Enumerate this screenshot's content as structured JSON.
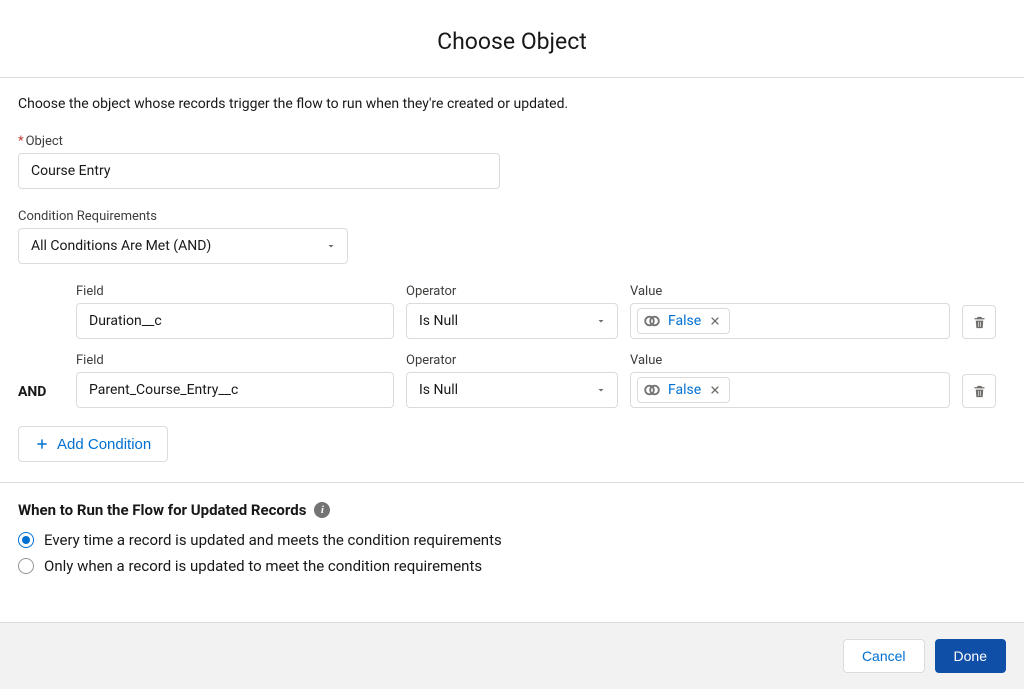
{
  "modal": {
    "title": "Choose Object",
    "helper": "Choose the object whose records trigger the flow to run when they're created or updated."
  },
  "object": {
    "label": "Object",
    "value": "Course Entry"
  },
  "conditionReq": {
    "label": "Condition Requirements",
    "value": "All Conditions Are Met (AND)"
  },
  "labels": {
    "field": "Field",
    "operator": "Operator",
    "value": "Value",
    "logic_and": "AND",
    "addCondition": "Add Condition"
  },
  "rows": [
    {
      "field": "Duration__c",
      "operator": "Is Null",
      "value": "False"
    },
    {
      "field": "Parent_Course_Entry__c",
      "operator": "Is Null",
      "value": "False"
    }
  ],
  "whenSection": {
    "heading": "When to Run the Flow for Updated Records",
    "options": [
      "Every time a record is updated and meets the condition requirements",
      "Only when a record is updated to meet the condition requirements"
    ]
  },
  "footer": {
    "cancel": "Cancel",
    "done": "Done"
  },
  "icons": {
    "plus": "plus-icon",
    "chevron": "chevron-down-icon",
    "boolean": "boolean-icon",
    "close": "close-icon",
    "trash": "trash-icon",
    "info": "info-icon"
  }
}
